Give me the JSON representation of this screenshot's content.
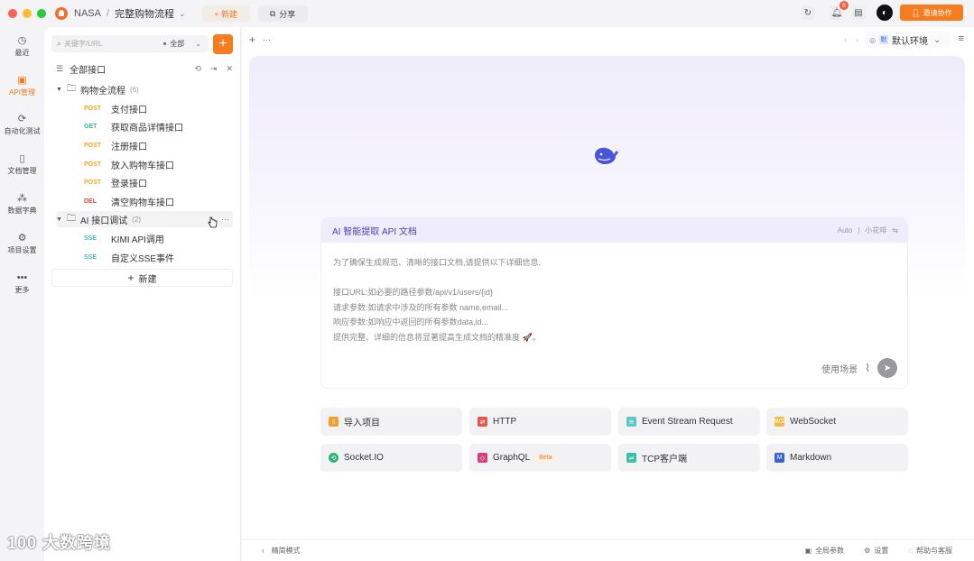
{
  "titlebar": {
    "project": "NASA",
    "separator": "/",
    "flow": "完整购物流程",
    "new_label": "+ 新建",
    "share_label": "分享",
    "notification_count": "8",
    "invite_label": "邀请协作"
  },
  "rail": [
    {
      "label": "最近",
      "icon": "clock-icon"
    },
    {
      "label": "API管理",
      "icon": "api-icon",
      "active": true
    },
    {
      "label": "自动化测试",
      "icon": "automation-icon"
    },
    {
      "label": "文档管理",
      "icon": "document-icon"
    },
    {
      "label": "数据字典",
      "icon": "data-dictionary-icon"
    },
    {
      "label": "项目设置",
      "icon": "settings-icon"
    },
    {
      "label": "更多",
      "icon": "more-icon"
    }
  ],
  "panel": {
    "search_placeholder": "关键字/URL",
    "filter_label": "全部",
    "all_apis": "全部接口",
    "new_label": "新建",
    "folders": [
      {
        "name": "购物全流程",
        "count": "(6)",
        "apis": [
          {
            "method": "POST",
            "name": "支付接口"
          },
          {
            "method": "GET",
            "name": "获取商品详情接口"
          },
          {
            "method": "POST",
            "name": "注册接口"
          },
          {
            "method": "POST",
            "name": "放入购物车接口"
          },
          {
            "method": "POST",
            "name": "登录接口"
          },
          {
            "method": "DEL",
            "name": "清空购物车接口"
          }
        ]
      },
      {
        "name": "AI 接口调试",
        "count": "(2)",
        "apis": [
          {
            "method": "SSE",
            "name": "KIMI API调用"
          },
          {
            "method": "SSE",
            "name": "自定义SSE事件"
          }
        ]
      }
    ]
  },
  "main": {
    "env_label": "默认环境",
    "env_badge": "默",
    "ai_card": {
      "title": "AI 智能提取 API 文档",
      "mode": "Auto",
      "divider": "|",
      "assistant": "小花啡",
      "lines": [
        "为了确保生成规范、清晰的接口文档,请提供以下详细信息.",
        "",
        "接口URL:如必要的路径参数/api/v1/users/{id}",
        "请求参数:如请求中涉及的所有参数 name,email...",
        "响应参数:如响应中返回的所有参数data,id...",
        "提供完整、详细的信息将显著提高生成文档的精准度 🚀。"
      ],
      "scenario_label": "使用场景"
    },
    "quick_actions": [
      {
        "label": "导入项目",
        "icon": "import-icon",
        "color": "#f0a030"
      },
      {
        "label": "HTTP",
        "icon": "http-icon",
        "color": "#e2574c"
      },
      {
        "label": "Event Stream Request",
        "icon": "event-stream-icon",
        "color": "#5ec8c8"
      },
      {
        "label": "WebSocket",
        "icon": "websocket-icon",
        "color": "#f5b942"
      },
      {
        "label": "Socket.IO",
        "icon": "socketio-icon",
        "color": "#2db37a"
      },
      {
        "label": "GraphQL",
        "icon": "graphql-icon",
        "color": "#d6407e",
        "badge": "Beta"
      },
      {
        "label": "TCP客户端",
        "icon": "tcp-icon",
        "color": "#38c0a8"
      },
      {
        "label": "Markdown",
        "icon": "markdown-icon",
        "color": "#3a63d6"
      }
    ]
  },
  "statusbar": {
    "compact_mode": "精简模式",
    "global_params": "全局参数",
    "settings": "设置",
    "help": "帮助与客服"
  },
  "watermark": "100 大数跨境"
}
